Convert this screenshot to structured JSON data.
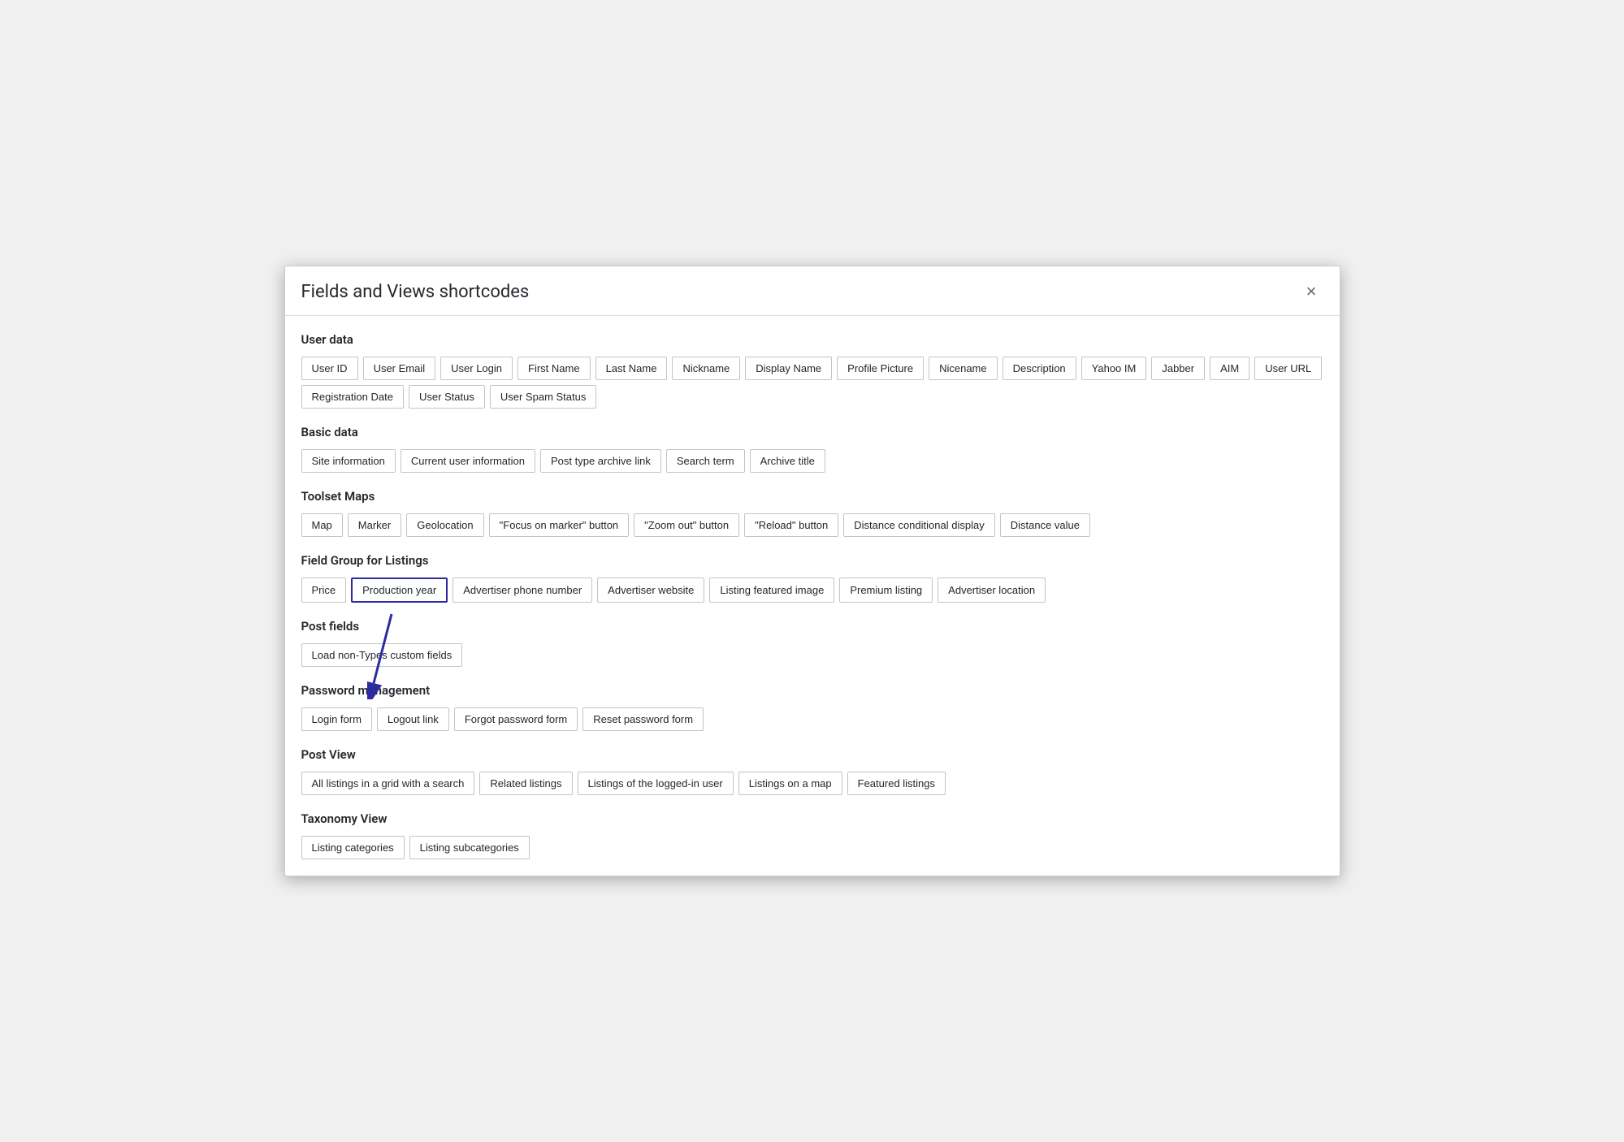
{
  "modal": {
    "title": "Fields and Views shortcodes",
    "close_label": "×"
  },
  "sections": [
    {
      "id": "user-data",
      "title": "User data",
      "tags": [
        "User ID",
        "User Email",
        "User Login",
        "First Name",
        "Last Name",
        "Nickname",
        "Display Name",
        "Profile Picture",
        "Nicename",
        "Description",
        "Yahoo IM",
        "Jabber",
        "AIM",
        "User URL",
        "Registration Date",
        "User Status",
        "User Spam Status"
      ]
    },
    {
      "id": "basic-data",
      "title": "Basic data",
      "tags": [
        "Site information",
        "Current user information",
        "Post type archive link",
        "Search term",
        "Archive title"
      ]
    },
    {
      "id": "toolset-maps",
      "title": "Toolset Maps",
      "tags": [
        "Map",
        "Marker",
        "Geolocation",
        "\"Focus on marker\" button",
        "\"Zoom out\" button",
        "\"Reload\" button",
        "Distance conditional display",
        "Distance value"
      ]
    },
    {
      "id": "field-group-listings",
      "title": "Field Group for Listings",
      "tags": [
        "Price",
        "Production year",
        "Advertiser phone number",
        "Advertiser website",
        "Listing featured image",
        "Premium listing",
        "Advertiser location"
      ],
      "highlighted": "Production year"
    },
    {
      "id": "post-fields",
      "title": "Post fields",
      "tags": [
        "Load non-Types custom fields"
      ]
    },
    {
      "id": "password-management",
      "title": "Password management",
      "tags": [
        "Login form",
        "Logout link",
        "Forgot password form",
        "Reset password form"
      ]
    },
    {
      "id": "post-view",
      "title": "Post View",
      "tags": [
        "All listings in a grid with a search",
        "Related listings",
        "Listings of the logged-in user",
        "Listings on a map",
        "Featured listings"
      ]
    },
    {
      "id": "taxonomy-view",
      "title": "Taxonomy View",
      "tags": [
        "Listing categories",
        "Listing subcategories"
      ]
    }
  ]
}
